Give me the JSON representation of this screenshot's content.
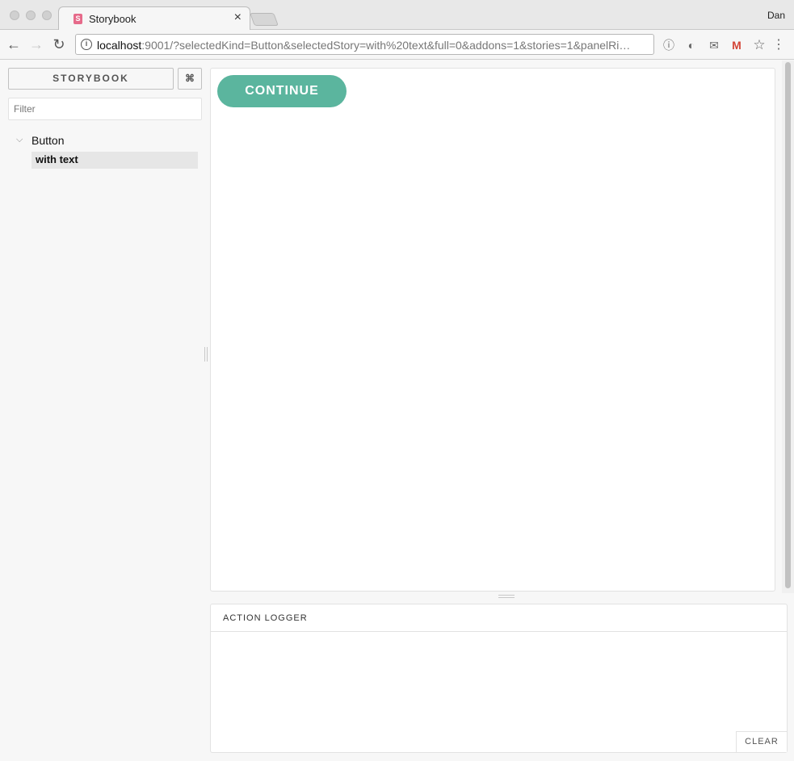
{
  "browser": {
    "tab_title": "Storybook",
    "tab_favicon": "S",
    "tab_close": "×",
    "profile_name": "Dan",
    "url_host": "localhost",
    "url_rest": ":9001/?selectedKind=Button&selectedStory=with%20text&full=0&addons=1&stories=1&panelRi…",
    "info_glyph": "i",
    "back": "←",
    "forward": "→",
    "reload": "↻",
    "ext_onepassword": "ⓘ",
    "ext_pie": "◐",
    "ext_mail": "✉",
    "ext_gmail": "M",
    "bookmark": "☆",
    "menu": "⋮"
  },
  "sidebar": {
    "title": "STORYBOOK",
    "shortcut": "⌘",
    "filter_placeholder": "Filter",
    "kind_chevron": "⌵",
    "kinds": [
      {
        "label": "Button",
        "stories": [
          {
            "label": "with text",
            "selected": true
          }
        ]
      }
    ]
  },
  "preview": {
    "button_label": "CONTINUE",
    "button_color": "#5bb59e"
  },
  "addon_panel": {
    "active_tab": "ACTION LOGGER",
    "clear_label": "CLEAR"
  }
}
